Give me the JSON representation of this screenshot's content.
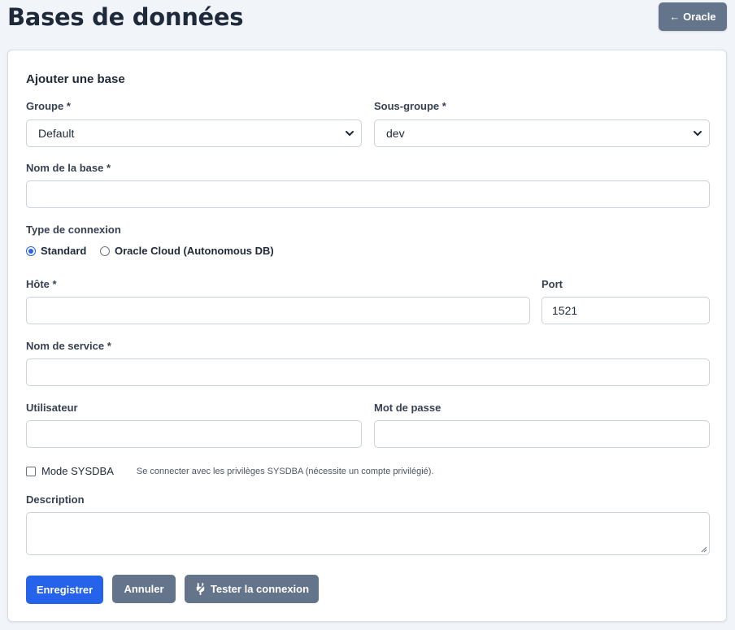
{
  "header": {
    "title": "Bases de données",
    "back_label": "← Oracle"
  },
  "form": {
    "title": "Ajouter une base",
    "group": {
      "label": "Groupe *",
      "value": "Default"
    },
    "subgroup": {
      "label": "Sous-groupe *",
      "value": "dev"
    },
    "db_name": {
      "label": "Nom de la base *",
      "value": ""
    },
    "connection_type": {
      "label": "Type de connexion",
      "options": [
        "Standard",
        "Oracle Cloud (Autonomous DB)"
      ],
      "selected": "Standard"
    },
    "host": {
      "label": "Hôte *",
      "value": ""
    },
    "port": {
      "label": "Port",
      "value": "1521"
    },
    "service_name": {
      "label": "Nom de service *",
      "value": ""
    },
    "user": {
      "label": "Utilisateur",
      "value": ""
    },
    "password": {
      "label": "Mot de passe",
      "value": ""
    },
    "sysdba": {
      "label": "Mode SYSDBA",
      "checked": false,
      "hint": "Se connecter avec les privilèges SYSDBA (nécessite un compte privilégié)."
    },
    "description": {
      "label": "Description",
      "value": ""
    },
    "buttons": {
      "save": "Enregistrer",
      "cancel": "Annuler",
      "test": "Tester la connexion"
    }
  },
  "icons": {
    "back": "arrow-left-icon",
    "test": "plug-icon",
    "select": "chevron-down-icon"
  },
  "colors": {
    "primary": "#2563eb",
    "secondary": "#64748b",
    "background": "#f1f4f8"
  }
}
